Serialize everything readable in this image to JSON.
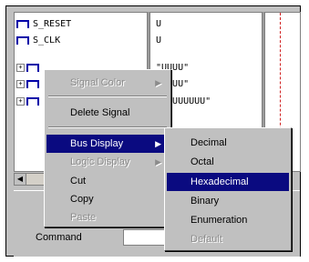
{
  "signals": [
    {
      "name": "S_RESET",
      "value": "U",
      "expandable": false
    },
    {
      "name": "S_CLK",
      "value": "U",
      "expandable": false
    },
    {
      "name": "",
      "value": "\"UUUU\"",
      "expandable": true
    },
    {
      "name": "",
      "value": "\"UUUU\"",
      "expandable": true
    },
    {
      "name": "",
      "value": "\"UUUUUUUU\"",
      "expandable": true
    }
  ],
  "command": {
    "label": "Command",
    "value": ""
  },
  "context_menu": {
    "items": [
      {
        "label": "Signal Color",
        "disabled": true,
        "submenu": true
      },
      {
        "label": "Delete Signal",
        "disabled": false,
        "submenu": false
      },
      {
        "label": "Bus Display",
        "disabled": false,
        "submenu": true,
        "selected": true
      },
      {
        "label": "Logic Display",
        "disabled": true,
        "submenu": true
      },
      {
        "label": "Cut",
        "disabled": false,
        "submenu": false
      },
      {
        "label": "Copy",
        "disabled": false,
        "submenu": false
      },
      {
        "label": "Paste",
        "disabled": true,
        "submenu": false
      }
    ]
  },
  "bus_display_submenu": {
    "items": [
      {
        "label": "Decimal",
        "selected": false,
        "disabled": false
      },
      {
        "label": "Octal",
        "selected": false,
        "disabled": false
      },
      {
        "label": "Hexadecimal",
        "selected": true,
        "disabled": false
      },
      {
        "label": "Binary",
        "selected": false,
        "disabled": false
      },
      {
        "label": "Enumeration",
        "selected": false,
        "disabled": false
      },
      {
        "label": "Default",
        "selected": false,
        "disabled": true
      }
    ]
  },
  "colors": {
    "highlight": "#0a0a80",
    "signal_icon": "#0000a8",
    "cursor_line": "#d02020"
  }
}
